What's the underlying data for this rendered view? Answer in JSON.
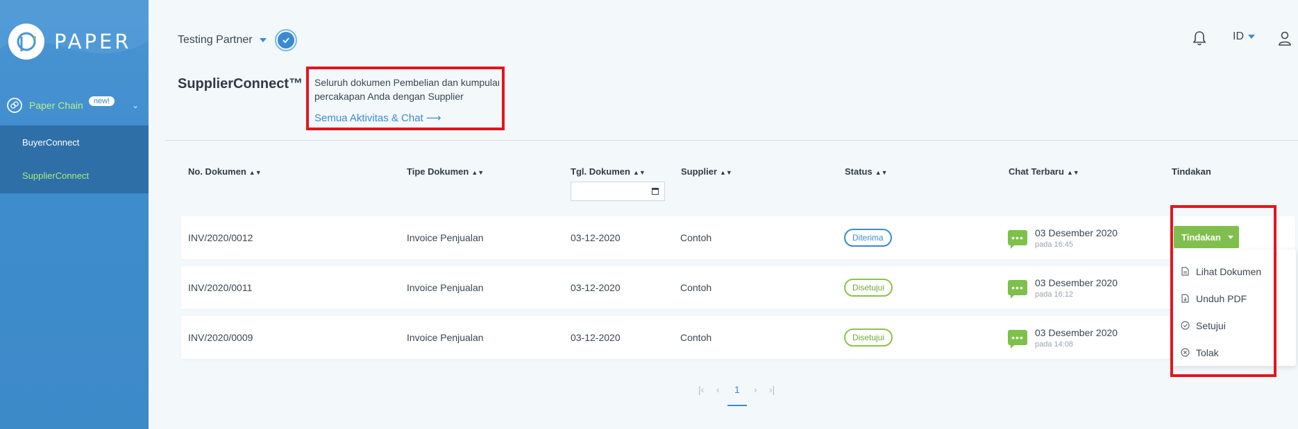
{
  "brand": {
    "name": "PAPER"
  },
  "sidebar": {
    "chain": {
      "label": "Paper Chain",
      "badge": "new!"
    },
    "items": [
      {
        "label": "BuyerConnect",
        "active": false
      },
      {
        "label": "SupplierConnect",
        "active": true
      }
    ]
  },
  "header": {
    "partner": "Testing Partner",
    "language": "ID"
  },
  "page": {
    "title": "SupplierConnect™",
    "info_line1": "Seluruh dokumen Pembelian dan kumpulan",
    "info_line2": "percakapan Anda dengan Supplier",
    "info_link": "Semua Aktivitas & Chat  ⟶"
  },
  "table": {
    "columns": {
      "doc_no": "No. Dokumen",
      "doc_type": "Tipe Dokumen",
      "doc_date": "Tgl. Dokumen",
      "supplier": "Supplier",
      "status": "Status",
      "chat": "Chat Terbaru",
      "actions": "Tindakan"
    },
    "rows": [
      {
        "doc_no": "INV/2020/0012",
        "doc_type": "Invoice Penjualan",
        "doc_date": "03-12-2020",
        "supplier": "Contoh",
        "status": "Diterima",
        "chat_date": "03 Desember 2020",
        "chat_time": "pada 16:45"
      },
      {
        "doc_no": "INV/2020/0011",
        "doc_type": "Invoice Penjualan",
        "doc_date": "03-12-2020",
        "supplier": "Contoh",
        "status": "Disetujui",
        "chat_date": "03 Desember 2020",
        "chat_time": "pada 16:12"
      },
      {
        "doc_no": "INV/2020/0009",
        "doc_type": "Invoice Penjualan",
        "doc_date": "03-12-2020",
        "supplier": "Contoh",
        "status": "Disetujui",
        "chat_date": "03 Desember 2020",
        "chat_time": "pada 14:08"
      }
    ]
  },
  "action_menu": {
    "button_label": "Tindakan",
    "items": [
      "Lihat Dokumen",
      "Unduh PDF",
      "Setujui",
      "Tolak"
    ]
  },
  "pagination": {
    "current": "1"
  },
  "colors": {
    "accent": "#3a8ad1",
    "success": "#80bf4e",
    "highlight": "#e3151d"
  }
}
